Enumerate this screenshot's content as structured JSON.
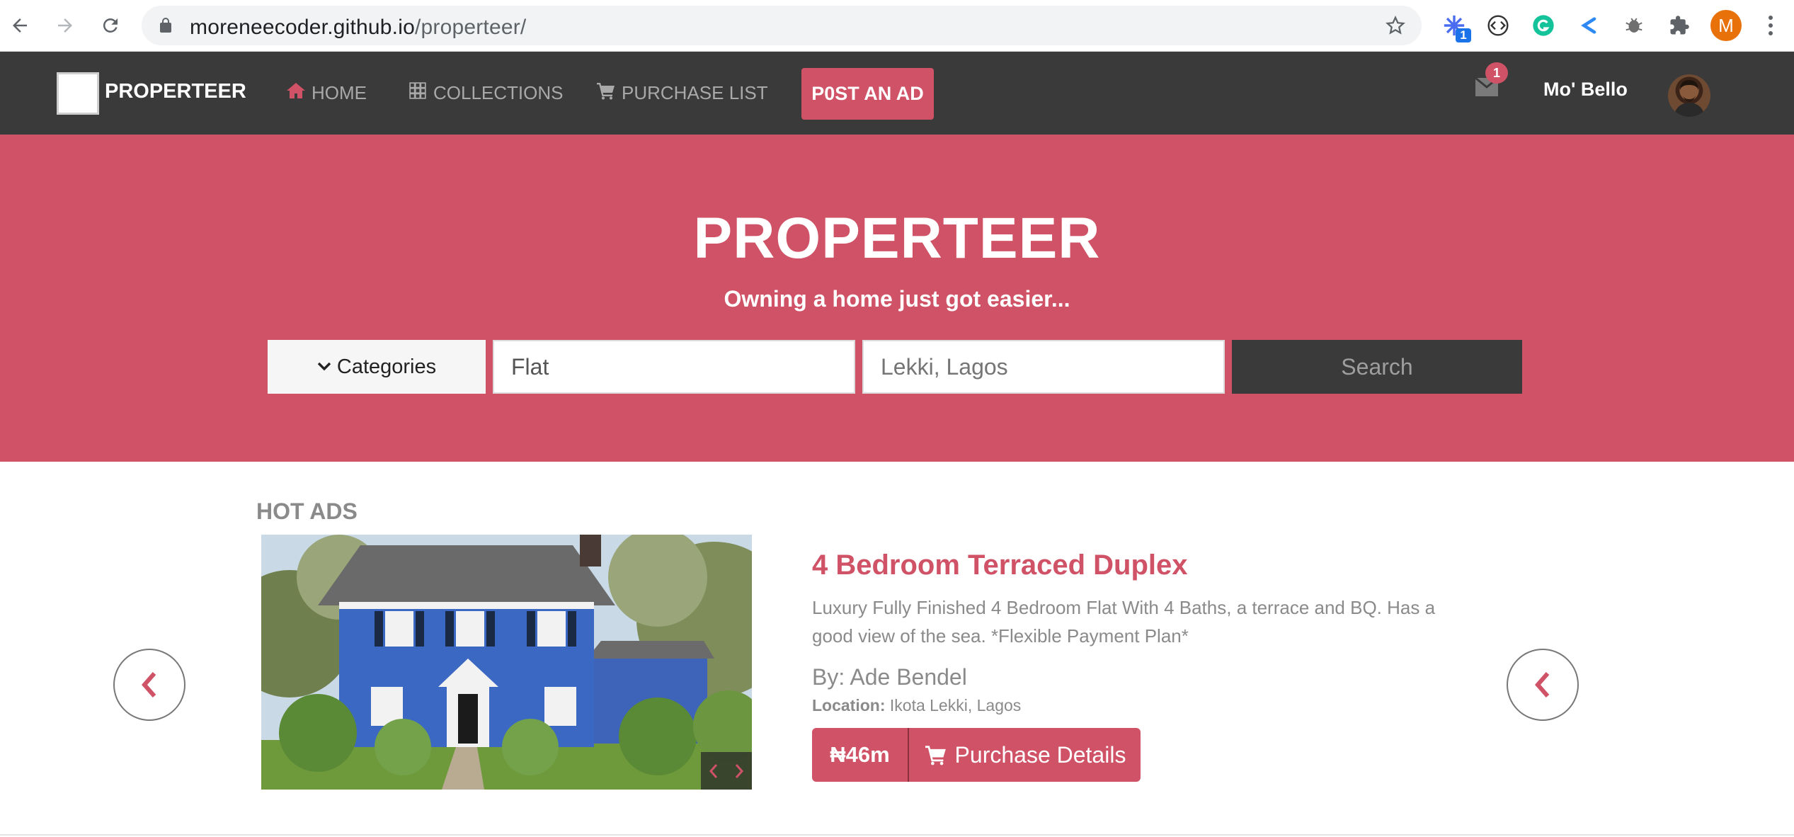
{
  "browser": {
    "url_host": "moreneecoder.github.io",
    "url_path": "/properteer/",
    "extension_badge": "1",
    "profile_initial": "M"
  },
  "navbar": {
    "brand": "PROPERTEER",
    "links": [
      {
        "label": "HOME",
        "icon": "home-icon"
      },
      {
        "label": "COLLECTIONS",
        "icon": "grid-icon"
      },
      {
        "label": "PURCHASE LIST",
        "icon": "cart-icon"
      }
    ],
    "post_ad": "P0ST AN AD",
    "mail_count": "1",
    "username": "Mo' Bello"
  },
  "hero": {
    "title": "PROPERTEER",
    "subtitle": "Owning a home just got easier...",
    "categories_label": "Categories",
    "type_value": "Flat",
    "location_placeholder": "Lekki, Lagos",
    "search_label": "Search"
  },
  "hot_ads": {
    "section_title": "HOT ADS",
    "ad": {
      "title": "4 Bedroom Terraced Duplex",
      "description": "Luxury Fully Finished 4 Bedroom Flat With 4 Baths, a terrace and BQ. Has a good view of the sea. *Flexible Payment Plan*",
      "by": "By: Ade Bendel",
      "location_label": "Location:",
      "location_value": "Ikota Lekki, Lagos",
      "price": "₦46m",
      "purchase_label": "Purchase Details"
    }
  },
  "colors": {
    "accent": "#d05266",
    "nav_bg": "#3a3a3a"
  }
}
